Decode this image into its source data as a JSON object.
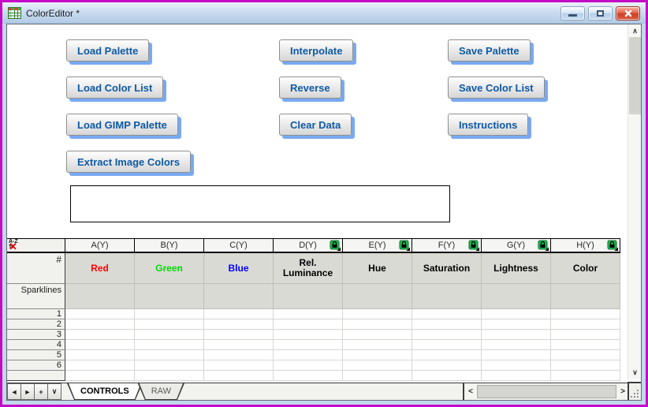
{
  "window": {
    "title": "ColorEditor *",
    "controls": [
      "minimize",
      "restore",
      "close"
    ]
  },
  "buttons": {
    "col1": [
      "Load Palette",
      "Load Color List",
      "Load GIMP Palette",
      "Extract Image Colors"
    ],
    "col2": [
      "Interpolate",
      "Reverse",
      "Clear Data"
    ],
    "col3": [
      "Save Palette",
      "Save Color List",
      "Instructions"
    ]
  },
  "colors": {
    "button_text": "#0f5aa5",
    "button_shadow": "#78a9f2",
    "window_border": "#c40ac4",
    "lock_green": "#1db954"
  },
  "sheet": {
    "columns": [
      {
        "header": "A(Y)",
        "longname": "Red",
        "color": "#ff0000",
        "locked": false
      },
      {
        "header": "B(Y)",
        "longname": "Green",
        "color": "#00dc00",
        "locked": false
      },
      {
        "header": "C(Y)",
        "longname": "Blue",
        "color": "#0000ff",
        "locked": false
      },
      {
        "header": "D(Y)",
        "longname": "Rel. Luminance",
        "color": "#000000",
        "locked": true
      },
      {
        "header": "E(Y)",
        "longname": "Hue",
        "color": "#000000",
        "locked": true
      },
      {
        "header": "F(Y)",
        "longname": "Saturation",
        "color": "#000000",
        "locked": true
      },
      {
        "header": "G(Y)",
        "longname": "Lightness",
        "color": "#000000",
        "locked": true
      },
      {
        "header": "H(Y)",
        "longname": "Color",
        "color": "#000000",
        "locked": true
      }
    ],
    "row_labels": {
      "index": "#",
      "sparklines": "Sparklines",
      "rows": [
        "1",
        "2",
        "3",
        "4",
        "5",
        "6"
      ]
    }
  },
  "sheetbar": {
    "nav": [
      "◄",
      "►",
      "+",
      "∨"
    ],
    "tabs": [
      {
        "label": "CONTROLS",
        "active": true
      },
      {
        "label": "RAW",
        "active": false
      }
    ]
  },
  "scrollbars": {
    "up": "∧",
    "down": "∨",
    "left": "<",
    "right": ">"
  }
}
